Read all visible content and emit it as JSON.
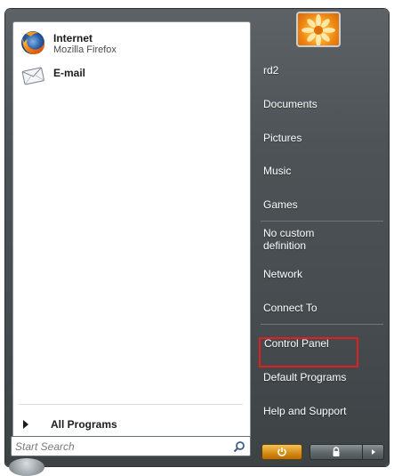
{
  "pinned": [
    {
      "name": "Internet",
      "sub": "Mozilla Firefox",
      "icon": "firefox-icon"
    },
    {
      "name": "E-mail",
      "sub": "",
      "icon": "email-icon"
    }
  ],
  "all_programs": {
    "label": "All Programs"
  },
  "search": {
    "placeholder": "Start Search",
    "icon": "search-icon"
  },
  "right_items": [
    {
      "key": "user",
      "label": "rd2"
    },
    {
      "key": "documents",
      "label": "Documents"
    },
    {
      "key": "pictures",
      "label": "Pictures"
    },
    {
      "key": "music",
      "label": "Music"
    },
    {
      "key": "games",
      "label": "Games"
    },
    {
      "key": "no-custom-definition",
      "label": "No custom definition"
    },
    {
      "key": "network",
      "label": "Network"
    },
    {
      "key": "connect-to",
      "label": "Connect To"
    },
    {
      "key": "control-panel",
      "label": "Control Panel"
    },
    {
      "key": "default-programs",
      "label": "Default Programs"
    },
    {
      "key": "help-and-support",
      "label": "Help and Support"
    }
  ],
  "power_buttons": {
    "power_icon": "power-icon",
    "lock_icon": "lock-icon",
    "more_icon": "arrow-right-icon"
  },
  "colors": {
    "highlight": "#e02020",
    "menu_bg": "#4d5356",
    "power": "#d98e17"
  }
}
